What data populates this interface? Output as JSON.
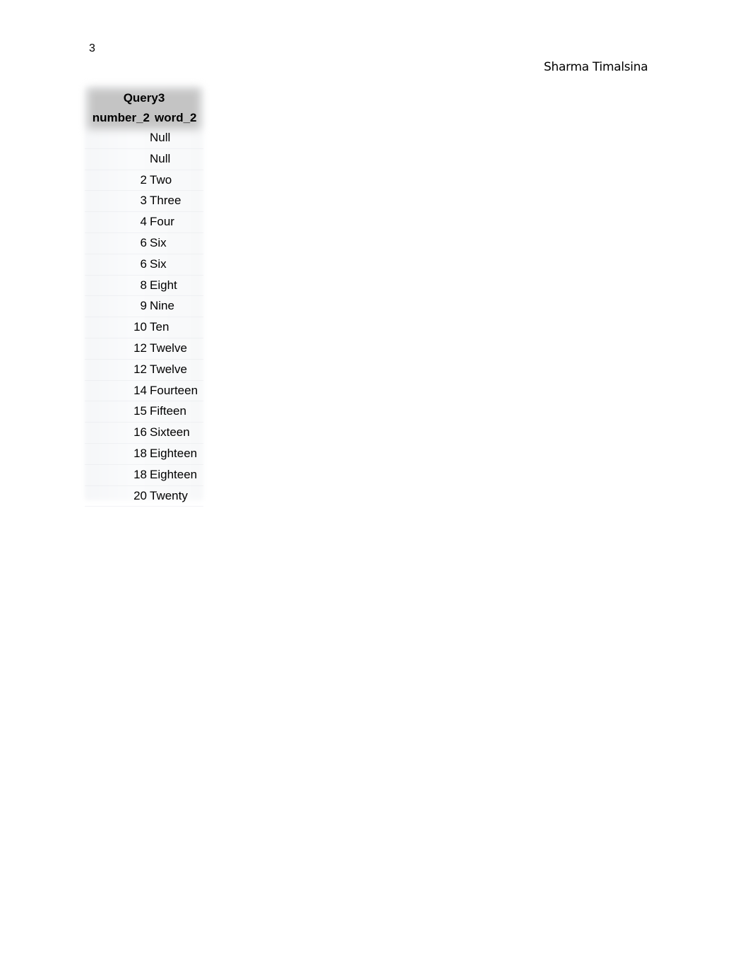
{
  "page": {
    "number": "3",
    "author": "Sharma Timalsina"
  },
  "table": {
    "title": "Query3",
    "columns": [
      "number_2",
      "word_2"
    ],
    "rows": [
      {
        "number_2": "",
        "word_2": "Null"
      },
      {
        "number_2": "",
        "word_2": "Null"
      },
      {
        "number_2": "2",
        "word_2": "Two"
      },
      {
        "number_2": "3",
        "word_2": "Three"
      },
      {
        "number_2": "4",
        "word_2": "Four"
      },
      {
        "number_2": "6",
        "word_2": "Six"
      },
      {
        "number_2": "6",
        "word_2": "Six"
      },
      {
        "number_2": "8",
        "word_2": "Eight"
      },
      {
        "number_2": "9",
        "word_2": "Nine"
      },
      {
        "number_2": "10",
        "word_2": "Ten"
      },
      {
        "number_2": "12",
        "word_2": "Twelve"
      },
      {
        "number_2": "12",
        "word_2": "Twelve"
      },
      {
        "number_2": "14",
        "word_2": "Fourteen"
      },
      {
        "number_2": "15",
        "word_2": "Fifteen"
      },
      {
        "number_2": "16",
        "word_2": "Sixteen"
      },
      {
        "number_2": "18",
        "word_2": "Eighteen"
      },
      {
        "number_2": "18",
        "word_2": "Eighteen"
      },
      {
        "number_2": "20",
        "word_2": "Twenty"
      }
    ]
  }
}
